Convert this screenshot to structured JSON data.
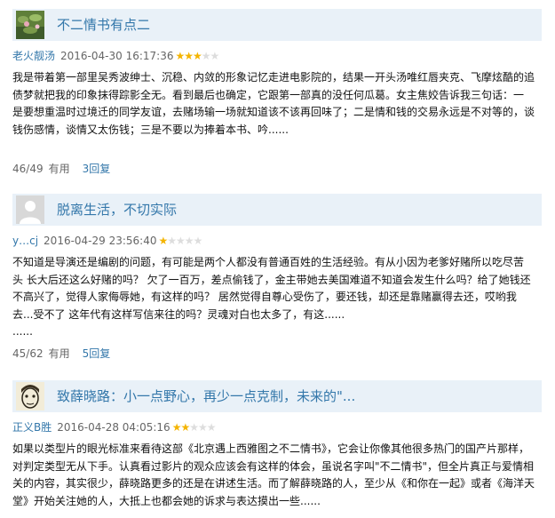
{
  "reviews": [
    {
      "title": "不二情书有点二",
      "author": "老火靓汤",
      "time": "2016-04-30 16:17:36",
      "rating": 3,
      "avatar_icon": "lotus-pond-avatar",
      "lines": [
        "我是带着第一部里吴秀波绅士、沉稳、内敛的形象记忆走进电影院的，结果一开头汤唯红唇夹克、飞摩炫酷的追",
        "债梦就把我的印象抹得踪影全无。看到最后也确定，它跟第一部真的没任何瓜葛。女主焦姣告诉我三句话：一",
        "是要想重温时过境迁的同学友谊，去赌场输一场就知道该不该再回味了；二是情和钱的交易永远是不对等的，谈",
        "钱伤感情，谈情又太伤钱；三是不要以为捧着本书、吟......"
      ],
      "useful": "46/49",
      "useful_label": "有用",
      "reply": "3回复"
    },
    {
      "title": "脱离生活，不切实际",
      "author": "y…cj",
      "time": "2016-04-29 23:56:40",
      "rating": 1,
      "avatar_icon": "default-user-avatar",
      "lines": [
        "不知道是导演还是编剧的问题，有可能是两个人都没有普通百姓的生活经验。有从小因为老爹好赌所以吃尽苦",
        "头 长大后还这么好赌的吗？ 欠了一百万，差点偷钱了，金主带她去美国难道不知道会发生什么吗？给了她钱还",
        "不高兴了，觉得人家侮辱她，有这样的吗？ 居然觉得自尊心受伤了，要还钱，却还是靠赌赢得去还，哎哟我",
        "去...受不了 这年代有这样写信来往的吗？灵魂对白也太多了，有这......",
        "......"
      ],
      "useful": "45/62",
      "useful_label": "有用",
      "reply": "5回复"
    },
    {
      "title": "致薛晓路：小一点野心，再少一点克制，未来的\"...",
      "author": "正义B胜",
      "time": "2016-04-28 04:05:16",
      "rating": 2,
      "avatar_icon": "sketch-face-avatar",
      "lines": [
        "如果以类型片的眼光标准来看待这部《北京遇上西雅图之不二情书》，它会让你像其他很多热门的国产片那样，",
        "对判定类型无从下手。认真看过影片的观众应该会有这样的体会，虽说名字叫\"不二情书\"，但全片真正与爱情相",
        "关的内容，其实很少，薛晓路更多的还是在讲述生活。而了解薛晓路的人，至少从《和你在一起》或者《海洋天",
        "堂》开始关注她的人，大抵上也都会她的诉求与表达摸出一些......"
      ]
    }
  ],
  "colors": {
    "link": "#3377aa",
    "header_bg": "#e9f1f8",
    "star_on": "#f4b400",
    "star_off": "#dddddd"
  }
}
